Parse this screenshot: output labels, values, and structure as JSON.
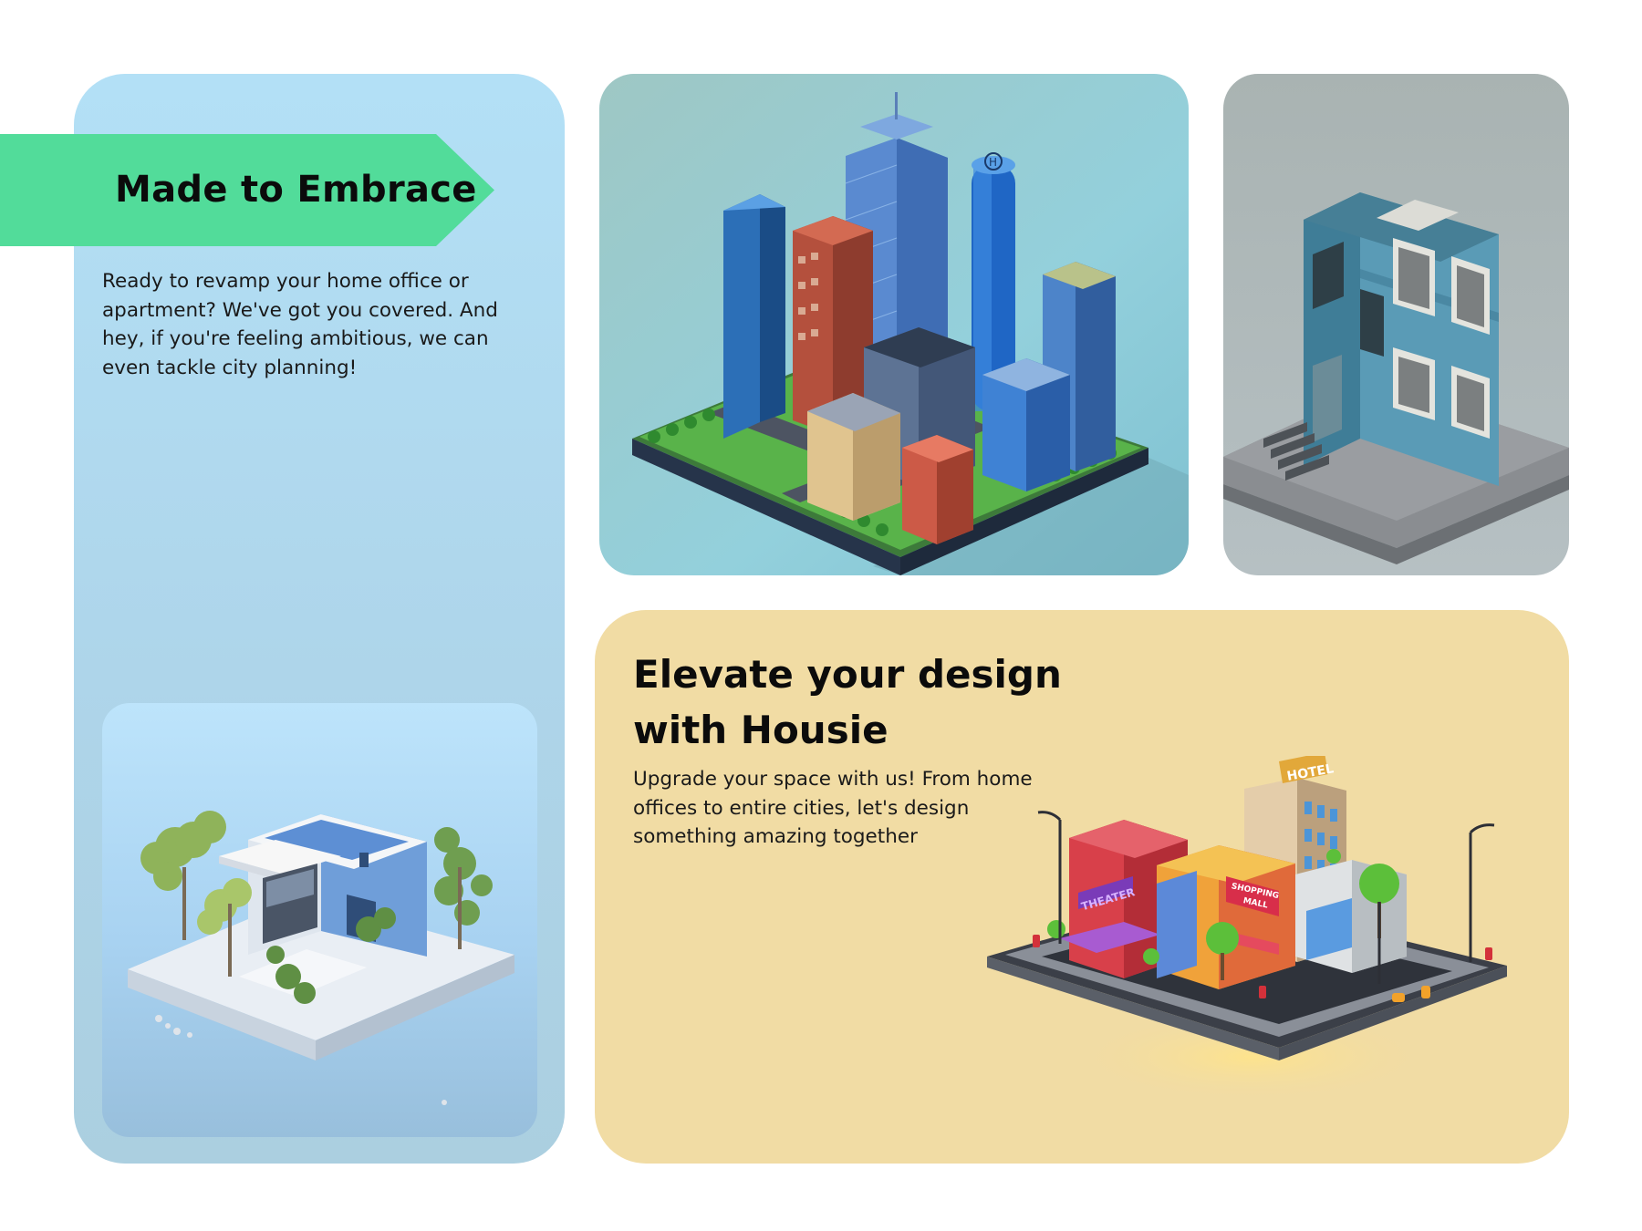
{
  "banner": {
    "title": "Made to Embrace",
    "color": "#52dc9a"
  },
  "intro": {
    "text": "Ready to revamp your home office or apartment? We've got you covered. And hey, if you're feeling ambitious, we can even tackle city planning!"
  },
  "promo": {
    "title": "Elevate your design with Housie",
    "text": "Upgrade your space with us! From home offices to entire cities, let's design something amazing together",
    "background": "#f1dca4"
  },
  "images": {
    "modern_house": "modern-house-illustration",
    "city_block": "city-block-illustration",
    "townhouse": "townhouse-illustration",
    "district": "district-illustration"
  },
  "signs": {
    "hotel": "HOTEL",
    "theater": "THEATER",
    "shopping_line1": "SHOPPING",
    "shopping_line2": "MALL"
  },
  "colors": {
    "left_card": "#b0d9ee",
    "accent_green": "#52dc9a"
  }
}
